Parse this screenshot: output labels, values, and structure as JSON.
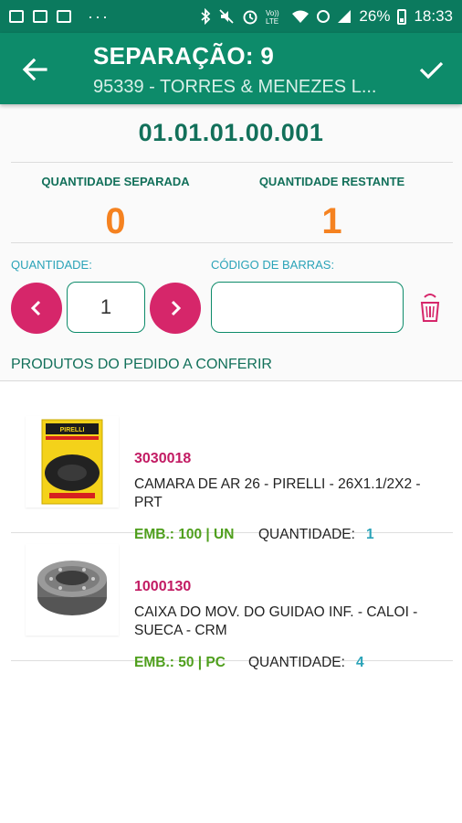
{
  "status_bar": {
    "left_icons": [
      "image-icon",
      "sd-card-icon",
      "calendar-icon"
    ],
    "dots": "···",
    "right_icons": [
      "bluetooth-icon",
      "mute-icon",
      "alarm-icon",
      "volte-icon",
      "wifi-icon",
      "signal-icon"
    ],
    "battery": "26%",
    "time": "18:33"
  },
  "appbar": {
    "title": "SEPARAÇÃO: 9",
    "subtitle": "95339 - TORRES & MENEZES L...",
    "back_icon": "arrow-left-icon",
    "confirm_icon": "check-icon"
  },
  "product_code": "01.01.01.00.001",
  "quantities": {
    "separated_label": "QUANTIDADE SEPARADA",
    "separated_value": "0",
    "remaining_label": "QUANTIDADE RESTANTE",
    "remaining_value": "1"
  },
  "form": {
    "quantity_label": "QUANTIDADE:",
    "quantity_value": "1",
    "barcode_label": "CÓDIGO DE BARRAS:",
    "barcode_value": "",
    "decrement_icon": "chevron-left-icon",
    "increment_icon": "chevron-right-icon",
    "clear_icon": "eraser-icon"
  },
  "section_title": "PRODUTOS DO PEDIDO A CONFERIR",
  "items": [
    {
      "code": "3030018",
      "description": "CAMARA DE AR 26 - PIRELLI - 26X1.1/2X2 - PRT",
      "emb": "EMB.: 100 | UN",
      "qty_label": "QUANTIDADE:",
      "qty": "1",
      "thumb_brand": "PIRELLI"
    },
    {
      "code": "1000130",
      "description": "CAIXA DO MOV. DO GUIDAO INF. - CALOI - SUECA - CRM",
      "emb": "EMB.: 50 | PC",
      "qty_label": "QUANTIDADE:",
      "qty": "4"
    }
  ],
  "colors": {
    "primary": "#0d8b6a",
    "primary_dark": "#0b7a5e",
    "accent": "#d6266a",
    "orange": "#f58220",
    "green": "#4f9f1d",
    "cyan": "#2aa3b8"
  }
}
